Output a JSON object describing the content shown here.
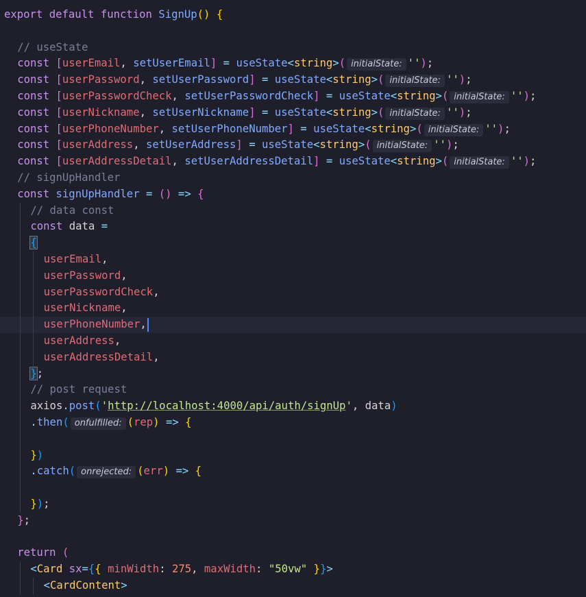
{
  "editor": {
    "lines": [
      {
        "indent": 0,
        "tokens": [
          {
            "c": "kw",
            "t": "export "
          },
          {
            "c": "kw",
            "t": "default "
          },
          {
            "c": "kw",
            "t": "function "
          },
          {
            "c": "fn-def",
            "t": "SignUp"
          },
          {
            "c": "bracket",
            "t": "()"
          },
          {
            "c": "punc",
            "t": " "
          },
          {
            "c": "bracket",
            "t": "{"
          }
        ]
      },
      {
        "indent": 0,
        "tokens": []
      },
      {
        "indent": 1,
        "tokens": [
          {
            "c": "cmt",
            "t": "// useState"
          }
        ]
      },
      {
        "indent": 1,
        "tokens": [
          {
            "c": "kw",
            "t": "const "
          },
          {
            "c": "bracket2",
            "t": "["
          },
          {
            "c": "var",
            "t": "userEmail"
          },
          {
            "c": "punc",
            "t": ", "
          },
          {
            "c": "fn",
            "t": "setUserEmail"
          },
          {
            "c": "bracket2",
            "t": "]"
          },
          {
            "c": "op",
            "t": " = "
          },
          {
            "c": "fn",
            "t": "useState"
          },
          {
            "c": "op",
            "t": "<"
          },
          {
            "c": "type",
            "t": "string"
          },
          {
            "c": "op",
            "t": ">"
          },
          {
            "c": "bracket2",
            "t": "("
          },
          {
            "c": "hint",
            "t": "initialState:"
          },
          {
            "c": "str",
            "t": "''"
          },
          {
            "c": "bracket2",
            "t": ")"
          },
          {
            "c": "punc",
            "t": ";"
          }
        ]
      },
      {
        "indent": 1,
        "tokens": [
          {
            "c": "kw",
            "t": "const "
          },
          {
            "c": "bracket2",
            "t": "["
          },
          {
            "c": "var",
            "t": "userPassword"
          },
          {
            "c": "punc",
            "t": ", "
          },
          {
            "c": "fn",
            "t": "setUserPassword"
          },
          {
            "c": "bracket2",
            "t": "]"
          },
          {
            "c": "op",
            "t": " = "
          },
          {
            "c": "fn",
            "t": "useState"
          },
          {
            "c": "op",
            "t": "<"
          },
          {
            "c": "type",
            "t": "string"
          },
          {
            "c": "op",
            "t": ">"
          },
          {
            "c": "bracket2",
            "t": "("
          },
          {
            "c": "hint",
            "t": "initialState:"
          },
          {
            "c": "str",
            "t": "''"
          },
          {
            "c": "bracket2",
            "t": ")"
          },
          {
            "c": "punc",
            "t": ";"
          }
        ]
      },
      {
        "indent": 1,
        "tokens": [
          {
            "c": "kw",
            "t": "const "
          },
          {
            "c": "bracket2",
            "t": "["
          },
          {
            "c": "var",
            "t": "userPasswordCheck"
          },
          {
            "c": "punc",
            "t": ", "
          },
          {
            "c": "fn",
            "t": "setUserPasswordCheck"
          },
          {
            "c": "bracket2",
            "t": "]"
          },
          {
            "c": "op",
            "t": " = "
          },
          {
            "c": "fn",
            "t": "useState"
          },
          {
            "c": "op",
            "t": "<"
          },
          {
            "c": "type",
            "t": "string"
          },
          {
            "c": "op",
            "t": ">"
          },
          {
            "c": "bracket2",
            "t": "("
          },
          {
            "c": "hint",
            "t": "initialState:"
          },
          {
            "c": "str",
            "t": "''"
          },
          {
            "c": "bracket2",
            "t": ")"
          },
          {
            "c": "punc",
            "t": ";"
          }
        ]
      },
      {
        "indent": 1,
        "tokens": [
          {
            "c": "kw",
            "t": "const "
          },
          {
            "c": "bracket2",
            "t": "["
          },
          {
            "c": "var",
            "t": "userNickname"
          },
          {
            "c": "punc",
            "t": ", "
          },
          {
            "c": "fn",
            "t": "setUserNickname"
          },
          {
            "c": "bracket2",
            "t": "]"
          },
          {
            "c": "op",
            "t": " = "
          },
          {
            "c": "fn",
            "t": "useState"
          },
          {
            "c": "op",
            "t": "<"
          },
          {
            "c": "type",
            "t": "string"
          },
          {
            "c": "op",
            "t": ">"
          },
          {
            "c": "bracket2",
            "t": "("
          },
          {
            "c": "hint",
            "t": "initialState:"
          },
          {
            "c": "str",
            "t": "''"
          },
          {
            "c": "bracket2",
            "t": ")"
          },
          {
            "c": "punc",
            "t": ";"
          }
        ]
      },
      {
        "indent": 1,
        "tokens": [
          {
            "c": "kw",
            "t": "const "
          },
          {
            "c": "bracket2",
            "t": "["
          },
          {
            "c": "var",
            "t": "userPhoneNumber"
          },
          {
            "c": "punc",
            "t": ", "
          },
          {
            "c": "fn",
            "t": "setUserPhoneNumber"
          },
          {
            "c": "bracket2",
            "t": "]"
          },
          {
            "c": "op",
            "t": " = "
          },
          {
            "c": "fn",
            "t": "useState"
          },
          {
            "c": "op",
            "t": "<"
          },
          {
            "c": "type",
            "t": "string"
          },
          {
            "c": "op",
            "t": ">"
          },
          {
            "c": "bracket2",
            "t": "("
          },
          {
            "c": "hint",
            "t": "initialState:"
          },
          {
            "c": "str",
            "t": "''"
          },
          {
            "c": "bracket2",
            "t": ")"
          },
          {
            "c": "punc",
            "t": ";"
          }
        ]
      },
      {
        "indent": 1,
        "tokens": [
          {
            "c": "kw",
            "t": "const "
          },
          {
            "c": "bracket2",
            "t": "["
          },
          {
            "c": "var",
            "t": "userAddress"
          },
          {
            "c": "punc",
            "t": ", "
          },
          {
            "c": "fn",
            "t": "setUserAddress"
          },
          {
            "c": "bracket2",
            "t": "]"
          },
          {
            "c": "op",
            "t": " = "
          },
          {
            "c": "fn",
            "t": "useState"
          },
          {
            "c": "op",
            "t": "<"
          },
          {
            "c": "type",
            "t": "string"
          },
          {
            "c": "op",
            "t": ">"
          },
          {
            "c": "bracket2",
            "t": "("
          },
          {
            "c": "hint",
            "t": "initialState:"
          },
          {
            "c": "str",
            "t": "''"
          },
          {
            "c": "bracket2",
            "t": ")"
          },
          {
            "c": "punc",
            "t": ";"
          }
        ]
      },
      {
        "indent": 1,
        "tokens": [
          {
            "c": "kw",
            "t": "const "
          },
          {
            "c": "bracket2",
            "t": "["
          },
          {
            "c": "var",
            "t": "userAddressDetail"
          },
          {
            "c": "punc",
            "t": ", "
          },
          {
            "c": "fn",
            "t": "setUserAddressDetail"
          },
          {
            "c": "bracket2",
            "t": "]"
          },
          {
            "c": "op",
            "t": " = "
          },
          {
            "c": "fn",
            "t": "useState"
          },
          {
            "c": "op",
            "t": "<"
          },
          {
            "c": "type",
            "t": "string"
          },
          {
            "c": "op",
            "t": ">"
          },
          {
            "c": "bracket2",
            "t": "("
          },
          {
            "c": "hint",
            "t": "initialState:"
          },
          {
            "c": "str",
            "t": "''"
          },
          {
            "c": "bracket2",
            "t": ")"
          },
          {
            "c": "punc",
            "t": ";"
          }
        ]
      },
      {
        "indent": 1,
        "tokens": [
          {
            "c": "cmt",
            "t": "// signUpHandler"
          }
        ]
      },
      {
        "indent": 1,
        "tokens": [
          {
            "c": "kw",
            "t": "const "
          },
          {
            "c": "fn",
            "t": "signUpHandler"
          },
          {
            "c": "op",
            "t": " = "
          },
          {
            "c": "bracket2",
            "t": "()"
          },
          {
            "c": "op",
            "t": " => "
          },
          {
            "c": "bracket2",
            "t": "{"
          }
        ]
      },
      {
        "indent": 2,
        "tokens": [
          {
            "c": "cmt",
            "t": "// data const"
          }
        ]
      },
      {
        "indent": 2,
        "tokens": [
          {
            "c": "kw",
            "t": "const "
          },
          {
            "c": "punc",
            "t": "data "
          },
          {
            "c": "op",
            "t": "="
          }
        ]
      },
      {
        "indent": 2,
        "tokens": [
          {
            "c": "bracket3-match",
            "t": "{"
          }
        ]
      },
      {
        "indent": 3,
        "tokens": [
          {
            "c": "var",
            "t": "userEmail"
          },
          {
            "c": "punc",
            "t": ","
          }
        ]
      },
      {
        "indent": 3,
        "tokens": [
          {
            "c": "var",
            "t": "userPassword"
          },
          {
            "c": "punc",
            "t": ","
          }
        ]
      },
      {
        "indent": 3,
        "tokens": [
          {
            "c": "var",
            "t": "userPasswordCheck"
          },
          {
            "c": "punc",
            "t": ","
          }
        ]
      },
      {
        "indent": 3,
        "tokens": [
          {
            "c": "var",
            "t": "userNickname"
          },
          {
            "c": "punc",
            "t": ","
          }
        ]
      },
      {
        "indent": 3,
        "current": true,
        "tokens": [
          {
            "c": "var",
            "t": "userPhoneNumber"
          },
          {
            "c": "punc",
            "t": ","
          },
          {
            "c": "cursor",
            "t": ""
          }
        ]
      },
      {
        "indent": 3,
        "tokens": [
          {
            "c": "var",
            "t": "userAddress"
          },
          {
            "c": "punc",
            "t": ","
          }
        ]
      },
      {
        "indent": 3,
        "tokens": [
          {
            "c": "var",
            "t": "userAddressDetail"
          },
          {
            "c": "punc",
            "t": ","
          }
        ]
      },
      {
        "indent": 2,
        "tokens": [
          {
            "c": "bracket3-match",
            "t": "}"
          },
          {
            "c": "punc",
            "t": ";"
          }
        ]
      },
      {
        "indent": 2,
        "tokens": [
          {
            "c": "cmt",
            "t": "// post request"
          }
        ]
      },
      {
        "indent": 2,
        "tokens": [
          {
            "c": "punc",
            "t": "axios"
          },
          {
            "c": "op",
            "t": "."
          },
          {
            "c": "fn",
            "t": "post"
          },
          {
            "c": "bracket3",
            "t": "("
          },
          {
            "c": "str",
            "t": "'"
          },
          {
            "c": "str-link",
            "t": "http://localhost:4000/api/auth/signUp"
          },
          {
            "c": "str",
            "t": "'"
          },
          {
            "c": "punc",
            "t": ", data"
          },
          {
            "c": "bracket3",
            "t": ")"
          }
        ]
      },
      {
        "indent": 2,
        "tokens": [
          {
            "c": "op",
            "t": "."
          },
          {
            "c": "fn",
            "t": "then"
          },
          {
            "c": "bracket3",
            "t": "("
          },
          {
            "c": "hint",
            "t": "onfulfilled:"
          },
          {
            "c": "bracket",
            "t": "("
          },
          {
            "c": "param",
            "t": "rep"
          },
          {
            "c": "bracket",
            "t": ")"
          },
          {
            "c": "op",
            "t": " => "
          },
          {
            "c": "bracket",
            "t": "{"
          }
        ]
      },
      {
        "indent": 2,
        "tokens": []
      },
      {
        "indent": 2,
        "tokens": [
          {
            "c": "bracket",
            "t": "}"
          },
          {
            "c": "bracket3",
            "t": ")"
          }
        ]
      },
      {
        "indent": 2,
        "tokens": [
          {
            "c": "op",
            "t": "."
          },
          {
            "c": "fn",
            "t": "catch"
          },
          {
            "c": "bracket3",
            "t": "("
          },
          {
            "c": "hint",
            "t": "onrejected:"
          },
          {
            "c": "bracket",
            "t": "("
          },
          {
            "c": "param",
            "t": "err"
          },
          {
            "c": "bracket",
            "t": ")"
          },
          {
            "c": "op",
            "t": " => "
          },
          {
            "c": "bracket",
            "t": "{"
          }
        ]
      },
      {
        "indent": 2,
        "tokens": []
      },
      {
        "indent": 2,
        "tokens": [
          {
            "c": "bracket",
            "t": "}"
          },
          {
            "c": "bracket3",
            "t": ")"
          },
          {
            "c": "punc",
            "t": ";"
          }
        ]
      },
      {
        "indent": 1,
        "tokens": [
          {
            "c": "bracket2",
            "t": "}"
          },
          {
            "c": "punc",
            "t": ";"
          }
        ]
      },
      {
        "indent": 0,
        "tokens": []
      },
      {
        "indent": 1,
        "tokens": [
          {
            "c": "kw",
            "t": "return "
          },
          {
            "c": "bracket2",
            "t": "("
          }
        ]
      },
      {
        "indent": 2,
        "tokens": [
          {
            "c": "op",
            "t": "<"
          },
          {
            "c": "tag",
            "t": "Card "
          },
          {
            "c": "attr",
            "t": "sx"
          },
          {
            "c": "op",
            "t": "="
          },
          {
            "c": "bracket3",
            "t": "{"
          },
          {
            "c": "bracket",
            "t": "{"
          },
          {
            "c": "punc",
            "t": " "
          },
          {
            "c": "var",
            "t": "minWidth"
          },
          {
            "c": "punc",
            "t": ": "
          },
          {
            "c": "num",
            "t": "275"
          },
          {
            "c": "punc",
            "t": ", "
          },
          {
            "c": "var",
            "t": "maxWidth"
          },
          {
            "c": "punc",
            "t": ": "
          },
          {
            "c": "str",
            "t": "\"50vw\""
          },
          {
            "c": "punc",
            "t": " "
          },
          {
            "c": "bracket",
            "t": "}"
          },
          {
            "c": "bracket3",
            "t": "}"
          },
          {
            "c": "op",
            "t": ">"
          }
        ]
      },
      {
        "indent": 3,
        "tokens": [
          {
            "c": "op",
            "t": "<"
          },
          {
            "c": "tag",
            "t": "CardContent"
          },
          {
            "c": "op",
            "t": ">"
          }
        ]
      }
    ]
  }
}
